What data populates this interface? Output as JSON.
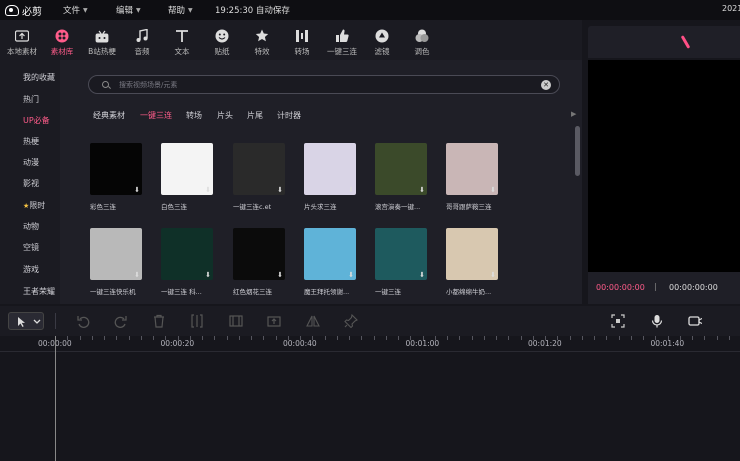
{
  "app": {
    "name": "必剪",
    "year": "2021"
  },
  "menus": [
    {
      "label": "文件"
    },
    {
      "label": "编辑"
    },
    {
      "label": "帮助"
    }
  ],
  "save_status": "19:25:30 自动保存",
  "tools": [
    {
      "label": "本地素材",
      "icon": "upload-icon"
    },
    {
      "label": "素材库",
      "icon": "material-library-icon"
    },
    {
      "label": "B站热梗",
      "icon": "bilibili-tv-icon"
    },
    {
      "label": "音频",
      "icon": "music-note-icon"
    },
    {
      "label": "文本",
      "icon": "text-t-icon"
    },
    {
      "label": "贴纸",
      "icon": "sticker-icon"
    },
    {
      "label": "特效",
      "icon": "effect-star-icon"
    },
    {
      "label": "转场",
      "icon": "transition-icon"
    },
    {
      "label": "一键三连",
      "icon": "thumbs-up-icon"
    },
    {
      "label": "滤镜",
      "icon": "filter-icon"
    },
    {
      "label": "调色",
      "icon": "color-adjust-icon"
    }
  ],
  "active_tool": "素材库",
  "categories": [
    {
      "label": "我的收藏"
    },
    {
      "label": "热门"
    },
    {
      "label": "UP必备"
    },
    {
      "label": "热梗"
    },
    {
      "label": "动漫"
    },
    {
      "label": "影视"
    },
    {
      "label": "限时"
    },
    {
      "label": "动物"
    },
    {
      "label": "空镜"
    },
    {
      "label": "游戏"
    },
    {
      "label": "王者荣耀"
    }
  ],
  "active_category": "UP必备",
  "search": {
    "placeholder": "搜索视频场景/元素"
  },
  "filter_tabs": [
    {
      "label": "经典素材"
    },
    {
      "label": "一键三连"
    },
    {
      "label": "转场"
    },
    {
      "label": "片头"
    },
    {
      "label": "片尾"
    },
    {
      "label": "计时器"
    }
  ],
  "active_filter": "一键三连",
  "cards": [
    {
      "caption": "彩色三连",
      "bg": "#050505"
    },
    {
      "caption": "白色三连",
      "bg": "#f4f4f4"
    },
    {
      "caption": "一键三连c.et",
      "bg": "#2a2a2a"
    },
    {
      "caption": "片头求三连",
      "bg": "#d9d4e6"
    },
    {
      "caption": "滚宫演奏一键...",
      "bg": "#3b4a2a"
    },
    {
      "caption": "哥哥跟萨鞍三连",
      "bg": "#c9b6b6"
    },
    {
      "caption": "一键三连快乐机",
      "bg": "#b9b9b9"
    },
    {
      "caption": "一键三连 科...",
      "bg": "#0f3028"
    },
    {
      "caption": "红色烟花三连",
      "bg": "#0b0b0b"
    },
    {
      "caption": "魔王拜托领谢...",
      "bg": "#5fb3d8"
    },
    {
      "caption": "一键三连",
      "bg": "#1e5a5e"
    },
    {
      "caption": "小都绵绵牛奶...",
      "bg": "#d8c8b0"
    }
  ],
  "preview": {
    "current_time": "00:00:00:00",
    "separator": "|",
    "duration": "00:00:00:00"
  },
  "timeline": {
    "marks": [
      "00:00:00",
      "00:00:20",
      "00:00:40",
      "00:01:00",
      "00:01:20",
      "00:01:40"
    ]
  },
  "colors": {
    "accent": "#ff5c8a",
    "bg": "#16161c",
    "panel": "#1f1f27"
  }
}
